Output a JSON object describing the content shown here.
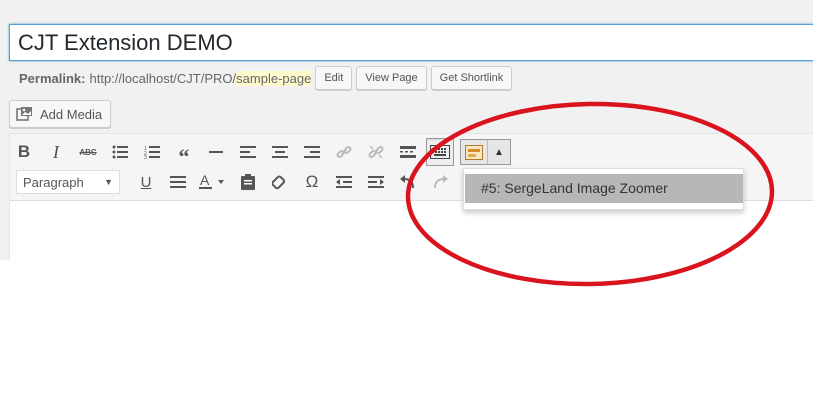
{
  "post": {
    "title": "CJT Extension DEMO"
  },
  "permalink": {
    "label": "Permalink:",
    "url_base": "http://localhost/CJT/PRO/",
    "slug": "sample-page",
    "buttons": [
      "Edit",
      "View Page",
      "Get Shortlink"
    ]
  },
  "media": {
    "add_label": "Add Media"
  },
  "toolbar": {
    "row1_icons": [
      "bold-icon",
      "italic-icon",
      "strikethrough-icon",
      "bulleted-list-icon",
      "numbered-list-icon",
      "blockquote-icon",
      "horizontal-line-icon",
      "align-left-icon",
      "align-center-icon",
      "align-right-icon",
      "insert-link-icon",
      "remove-link-icon",
      "read-more-icon",
      "toolbar-toggle-icon",
      "cjt-block-icon"
    ],
    "format_select": "Paragraph",
    "row2_icons": [
      "underline-icon",
      "justify-icon",
      "text-color-icon",
      "paste-text-icon",
      "clear-formatting-icon",
      "special-character-icon",
      "outdent-icon",
      "indent-icon",
      "undo-icon",
      "redo-icon"
    ]
  },
  "dropdown": {
    "items": [
      "#5: SergeLand Image Zoomer"
    ]
  },
  "colors": {
    "annotation_red": "#d9141e",
    "focus_border": "#5b9dd9",
    "slug_highlight": "#fffbcc",
    "menu_selected": "#b7b7b7"
  }
}
